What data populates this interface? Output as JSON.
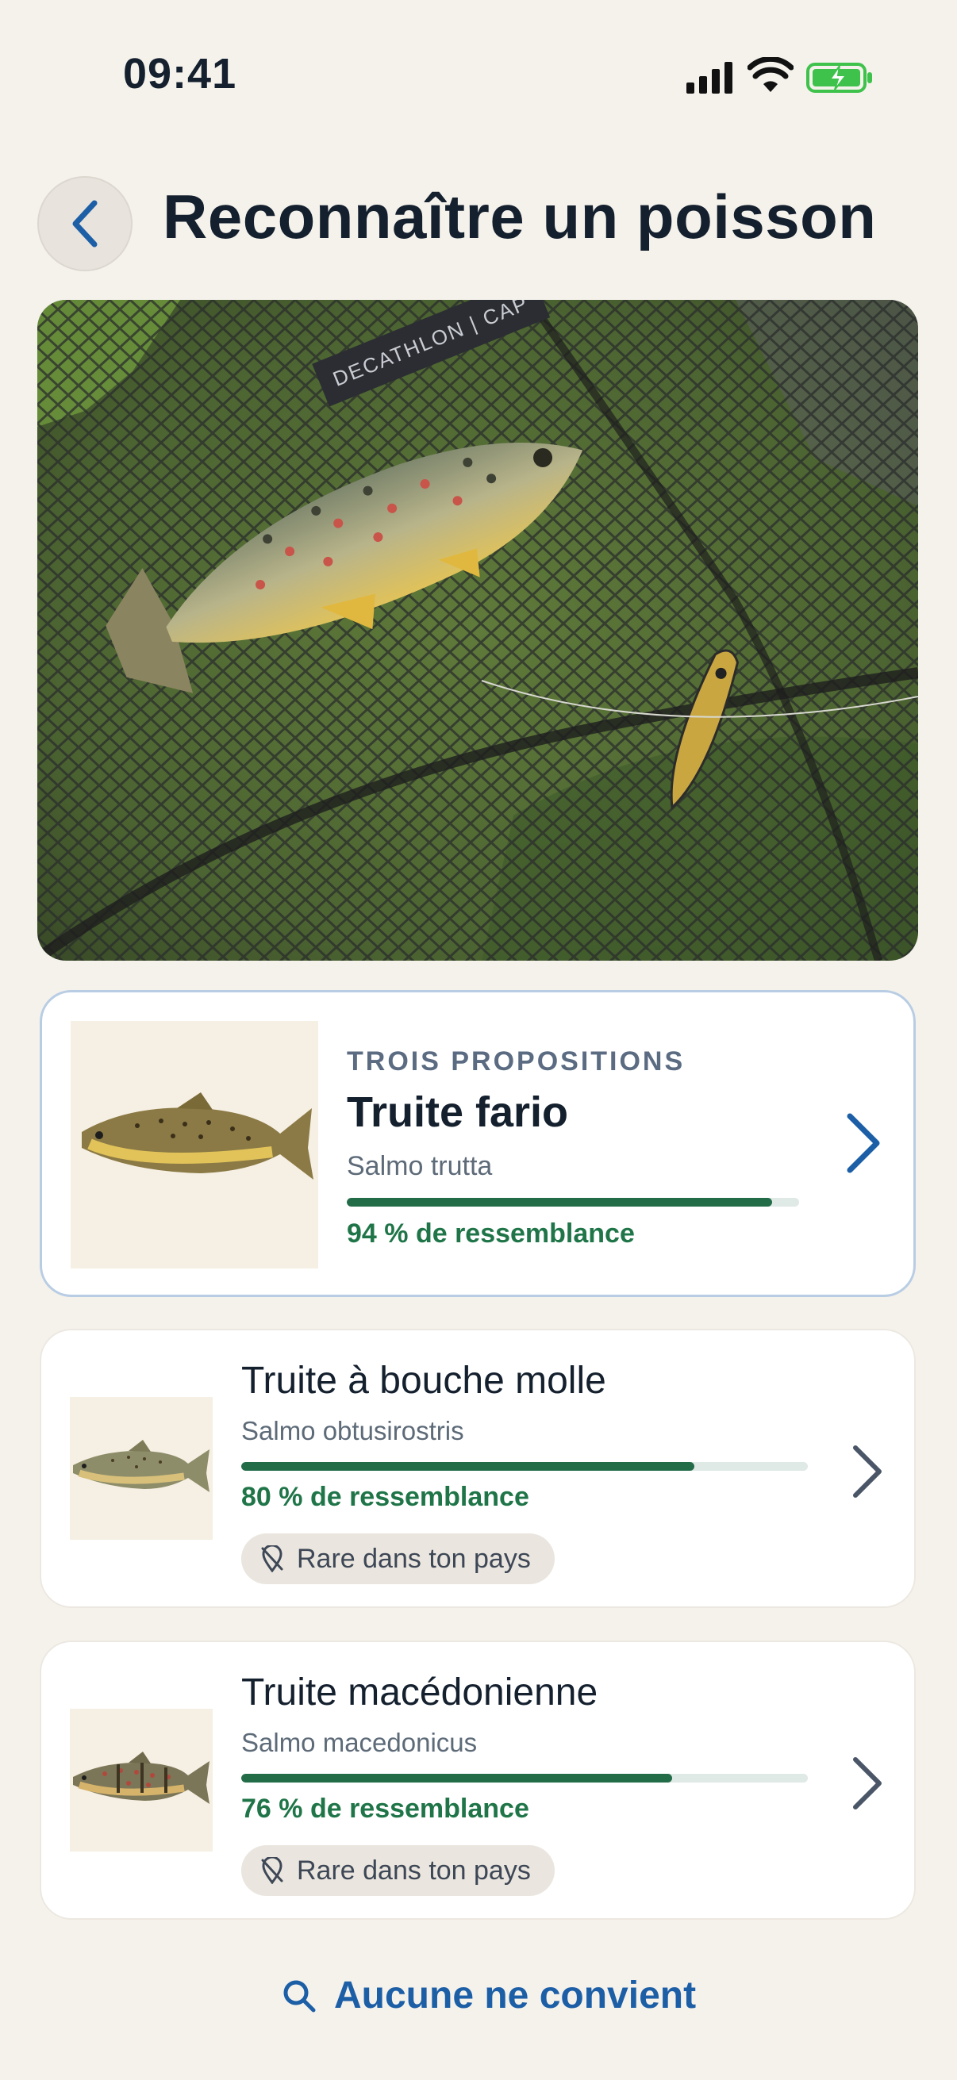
{
  "status_bar": {
    "time": "09:41",
    "icons": [
      "signal-icon",
      "wifi-icon",
      "battery-charging-icon"
    ],
    "battery_color": "#3ec24b"
  },
  "header": {
    "back_icon": "chevron-left-icon",
    "title": "Reconnaître un poisson"
  },
  "photo": {
    "net_label": "DECATHLON | CAP"
  },
  "results": {
    "section_label": "TROIS PROPOSITIONS",
    "items": [
      {
        "name": "Truite fario",
        "latin": "Salmo trutta",
        "similarity": 0.94,
        "similarity_label": "94 % de ressemblance",
        "badge": null
      },
      {
        "name": "Truite à bouche molle",
        "latin": "Salmo obtusirostris",
        "similarity": 0.8,
        "similarity_label": "80 % de ressemblance",
        "badge": "Rare dans ton pays"
      },
      {
        "name": "Truite macédonienne",
        "latin": "Salmo macedonicus",
        "similarity": 0.76,
        "similarity_label": "76 % de ressemblance",
        "badge": "Rare dans ton pays"
      }
    ]
  },
  "footer": {
    "icon": "search-icon",
    "link_label": "Aucune ne convient"
  },
  "colors": {
    "background": "#f5f2ec",
    "accent_blue": "#1d5fa6",
    "progress_green": "#236c48",
    "progress_track": "#dfe9e6",
    "highlight_border": "#b8cde4"
  }
}
